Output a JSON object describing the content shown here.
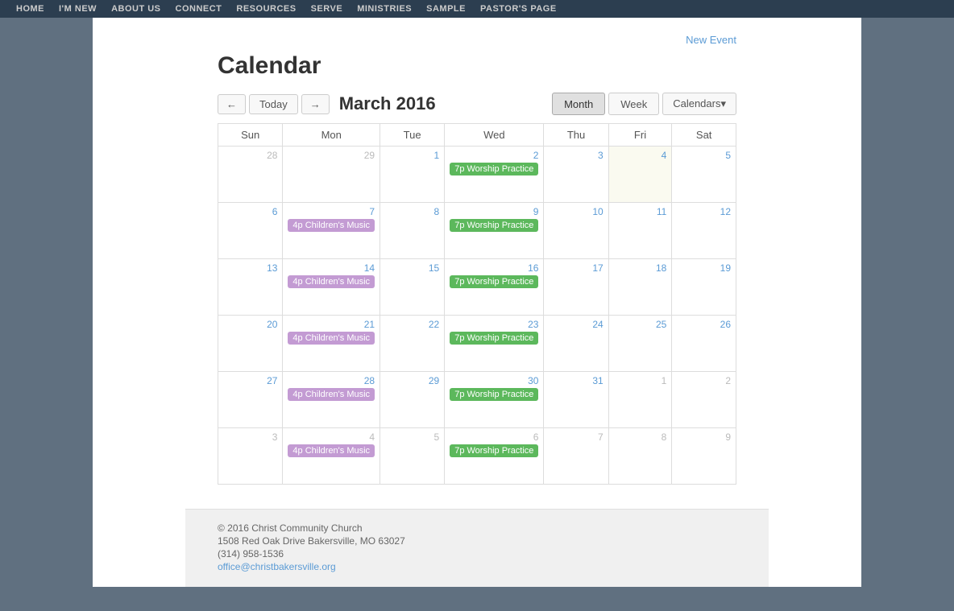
{
  "nav": {
    "items": [
      {
        "label": "HOME",
        "id": "home"
      },
      {
        "label": "I'M NEW",
        "id": "im-new"
      },
      {
        "label": "ABOUT US",
        "id": "about-us"
      },
      {
        "label": "CONNECT",
        "id": "connect"
      },
      {
        "label": "RESOURCES",
        "id": "resources"
      },
      {
        "label": "SERVE",
        "id": "serve"
      },
      {
        "label": "MINISTRIES",
        "id": "ministries"
      },
      {
        "label": "SAMPLE",
        "id": "sample"
      },
      {
        "label": "PASTOR'S PAGE",
        "id": "pastors-page"
      }
    ]
  },
  "page": {
    "new_event": "New Event",
    "title": "Calendar",
    "month_label": "March 2016"
  },
  "controls": {
    "prev": "←",
    "next": "→",
    "today": "Today",
    "month_btn": "Month",
    "week_btn": "Week",
    "calendars_btn": "Calendars▾"
  },
  "days_of_week": [
    "Sun",
    "Mon",
    "Tue",
    "Wed",
    "Thu",
    "Fri",
    "Sat"
  ],
  "calendar_rows": [
    {
      "cells": [
        {
          "day": "28",
          "month_class": "other-month",
          "events": []
        },
        {
          "day": "29",
          "month_class": "other-month",
          "events": []
        },
        {
          "day": "1",
          "month_class": "current-month",
          "events": []
        },
        {
          "day": "2",
          "month_class": "current-month",
          "events": [
            {
              "type": "green",
              "label": "7p Worship Practice"
            }
          ]
        },
        {
          "day": "3",
          "month_class": "current-month",
          "events": []
        },
        {
          "day": "4",
          "month_class": "current-month",
          "events": [],
          "today": true
        },
        {
          "day": "5",
          "month_class": "current-month",
          "events": []
        }
      ]
    },
    {
      "cells": [
        {
          "day": "6",
          "month_class": "current-month",
          "events": []
        },
        {
          "day": "7",
          "month_class": "current-month",
          "events": [
            {
              "type": "purple",
              "label": "4p Children's Music"
            }
          ]
        },
        {
          "day": "8",
          "month_class": "current-month",
          "events": []
        },
        {
          "day": "9",
          "month_class": "current-month",
          "events": [
            {
              "type": "green",
              "label": "7p Worship Practice"
            }
          ]
        },
        {
          "day": "10",
          "month_class": "current-month",
          "events": []
        },
        {
          "day": "11",
          "month_class": "current-month",
          "events": []
        },
        {
          "day": "12",
          "month_class": "current-month",
          "events": []
        }
      ]
    },
    {
      "cells": [
        {
          "day": "13",
          "month_class": "current-month",
          "events": []
        },
        {
          "day": "14",
          "month_class": "current-month",
          "events": [
            {
              "type": "purple",
              "label": "4p Children's Music"
            }
          ]
        },
        {
          "day": "15",
          "month_class": "current-month",
          "events": []
        },
        {
          "day": "16",
          "month_class": "current-month",
          "events": [
            {
              "type": "green",
              "label": "7p Worship Practice"
            }
          ]
        },
        {
          "day": "17",
          "month_class": "current-month",
          "events": []
        },
        {
          "day": "18",
          "month_class": "current-month",
          "events": []
        },
        {
          "day": "19",
          "month_class": "current-month",
          "events": []
        }
      ]
    },
    {
      "cells": [
        {
          "day": "20",
          "month_class": "current-month",
          "events": []
        },
        {
          "day": "21",
          "month_class": "current-month",
          "events": [
            {
              "type": "purple",
              "label": "4p Children's Music"
            }
          ]
        },
        {
          "day": "22",
          "month_class": "current-month",
          "events": []
        },
        {
          "day": "23",
          "month_class": "current-month",
          "events": [
            {
              "type": "green",
              "label": "7p Worship Practice"
            }
          ]
        },
        {
          "day": "24",
          "month_class": "current-month",
          "events": []
        },
        {
          "day": "25",
          "month_class": "current-month",
          "events": []
        },
        {
          "day": "26",
          "month_class": "current-month",
          "events": []
        }
      ]
    },
    {
      "cells": [
        {
          "day": "27",
          "month_class": "current-month",
          "events": []
        },
        {
          "day": "28",
          "month_class": "current-month",
          "events": [
            {
              "type": "purple",
              "label": "4p Children's Music"
            }
          ]
        },
        {
          "day": "29",
          "month_class": "current-month",
          "events": []
        },
        {
          "day": "30",
          "month_class": "current-month",
          "events": [
            {
              "type": "green",
              "label": "7p Worship Practice"
            }
          ]
        },
        {
          "day": "31",
          "month_class": "current-month",
          "events": []
        },
        {
          "day": "1",
          "month_class": "other-month",
          "events": []
        },
        {
          "day": "2",
          "month_class": "other-month",
          "events": []
        }
      ]
    },
    {
      "cells": [
        {
          "day": "3",
          "month_class": "other-month",
          "events": []
        },
        {
          "day": "4",
          "month_class": "other-month",
          "events": [
            {
              "type": "purple",
              "label": "4p Children's Music"
            }
          ]
        },
        {
          "day": "5",
          "month_class": "other-month",
          "events": []
        },
        {
          "day": "6",
          "month_class": "other-month",
          "events": [
            {
              "type": "green",
              "label": "7p Worship Practice"
            }
          ]
        },
        {
          "day": "7",
          "month_class": "other-month",
          "events": []
        },
        {
          "day": "8",
          "month_class": "other-month",
          "events": []
        },
        {
          "day": "9",
          "month_class": "other-month",
          "events": []
        }
      ]
    }
  ],
  "footer": {
    "copyright": "© 2016 Christ Community Church",
    "address": "1508 Red Oak Drive Bakersville, MO 63027",
    "phone": "(314) 958-1536",
    "email": "office@christbakersville.org"
  }
}
